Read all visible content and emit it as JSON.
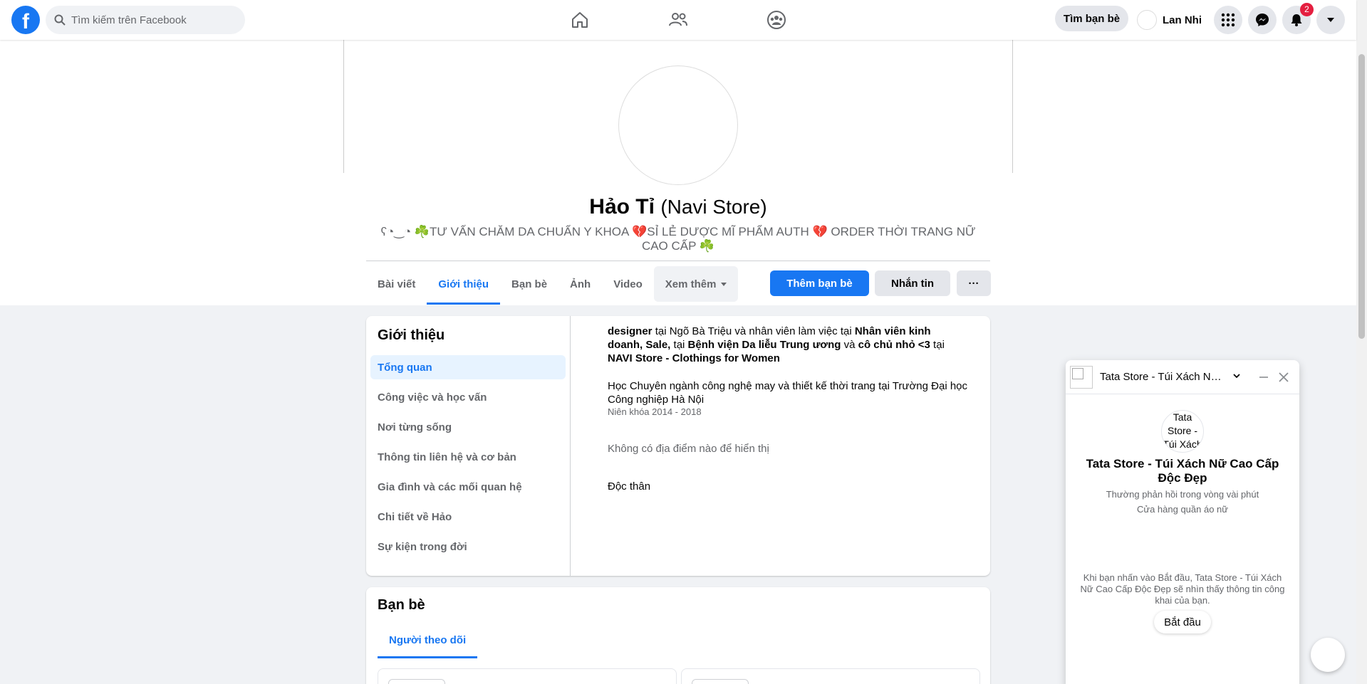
{
  "topbar": {
    "logo": "f",
    "search_placeholder": "Tìm kiếm trên Facebook",
    "find_friends_label": "Tìm bạn bè",
    "user_name": "Lan Nhi",
    "notification_count": "2",
    "nav_icons": [
      "home-icon",
      "friends-icon",
      "groups-icon"
    ]
  },
  "profile": {
    "name": "Hảo Tỉ",
    "alt_name": "(Navi Store)",
    "bio": "ʕ◔‿◔ ☘️TƯ VẤN CHĂM DA CHUẨN Y KHOA 💔SỈ LẺ DƯỢC MĨ PHẨM AUTH 💔 ORDER THỜI TRANG NỮ CAO CẤP ☘️",
    "tabs": [
      {
        "label": "Bài viết",
        "active": false
      },
      {
        "label": "Giới thiệu",
        "active": true
      },
      {
        "label": "Bạn bè",
        "active": false
      },
      {
        "label": "Ảnh",
        "active": false
      },
      {
        "label": "Video",
        "active": false
      }
    ],
    "more_tab_label": "Xem thêm",
    "add_friend_label": "Thêm bạn bè",
    "message_label": "Nhắn tin",
    "more_actions_label": "···"
  },
  "intro": {
    "title": "Giới thiệu",
    "nav": [
      {
        "label": "Tổng quan",
        "active": true
      },
      {
        "label": "Công việc và học vấn",
        "active": false
      },
      {
        "label": "Nơi từng sống",
        "active": false
      },
      {
        "label": "Thông tin liên hệ và cơ bản",
        "active": false
      },
      {
        "label": "Gia đình và các mối quan hệ",
        "active": false
      },
      {
        "label": "Chi tiết về Hảo",
        "active": false
      },
      {
        "label": "Sự kiện trong đời",
        "active": false
      }
    ],
    "work": {
      "part1_bold": "designer",
      "part2": " tại Ngõ Bà Triệu và nhân viên làm việc tại ",
      "part3_bold": "Nhân viên kinh doanh, Sale,",
      "part4": " tại ",
      "part5_bold": "Bệnh viện Da liễu Trung ương",
      "part6": " và ",
      "part7_bold": "cô chủ nhỏ <3",
      "part8": " tại ",
      "part9_bold": "NAVI Store - Clothings for Women"
    },
    "education": "Học Chuyên ngành công nghệ may và thiết kế thời trang tại Trường Đại học Công nghiệp Hà Nội",
    "education_years": "Niên khóa 2014 - 2018",
    "places": "Không có địa điểm nào để hiển thị",
    "relationship": "Độc thân"
  },
  "friends": {
    "title": "Bạn bè",
    "tab_label": "Người theo dõi"
  },
  "chat": {
    "header_title": "Tata Store - Túi Xách Nữ Cao Cấp Độc Đẹp",
    "avatar_alt": "Tata Store - Túi Xách",
    "page_name": "Tata Store - Túi Xách Nữ Cao Cấp Độc Đẹp",
    "response_time": "Thường phản hồi trong vòng vài phút",
    "category": "Cửa hàng quần áo nữ",
    "privacy_note": "Khi bạn nhấn vào Bắt đầu, Tata Store - Túi Xách Nữ Cao Cấp Độc Đẹp sẽ nhìn thấy thông tin công khai của bạn.",
    "start_label": "Bắt đầu"
  },
  "colors": {
    "brand": "#1877f2",
    "background": "#f0f2f5",
    "badge": "#e41e3f"
  }
}
